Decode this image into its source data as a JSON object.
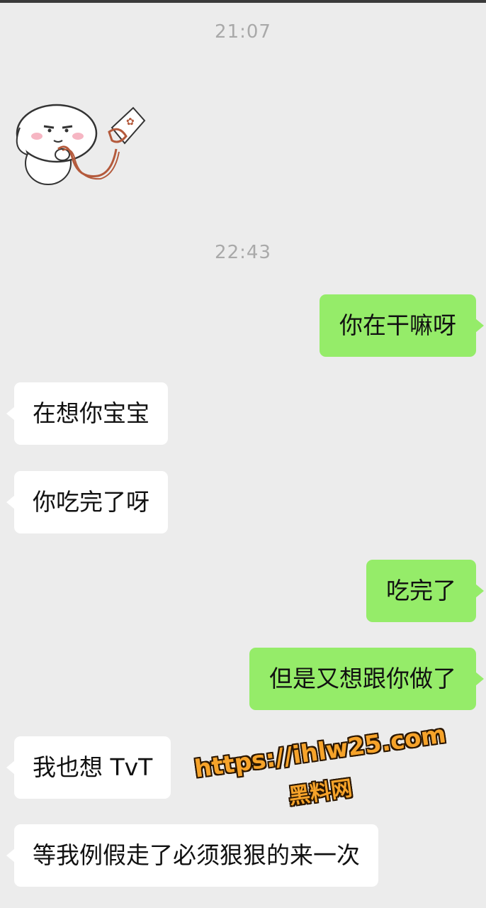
{
  "timestamps": [
    "21:07",
    "22:43"
  ],
  "messages": [
    {
      "side": "out",
      "text": "你在干嘛呀"
    },
    {
      "side": "in",
      "text": "在想你宝宝"
    },
    {
      "side": "in",
      "text": "你吃完了呀"
    },
    {
      "side": "out",
      "text": "吃完了"
    },
    {
      "side": "out",
      "text": "但是又想跟你做了"
    },
    {
      "side": "in",
      "text": "我也想 TvT"
    },
    {
      "side": "in",
      "text": "等我例假走了必须狠狠的来一次"
    }
  ],
  "sticker": {
    "icon": "bunny-holding-leash-sticker"
  },
  "watermark": {
    "url": "https://ihlw25.com",
    "name": "黑料网"
  },
  "colors": {
    "background": "#ececec",
    "incoming_bubble": "#ffffff",
    "outgoing_bubble": "#95ec69",
    "timestamp": "#a9a9a9",
    "watermark_fill": "#f6a32a"
  }
}
